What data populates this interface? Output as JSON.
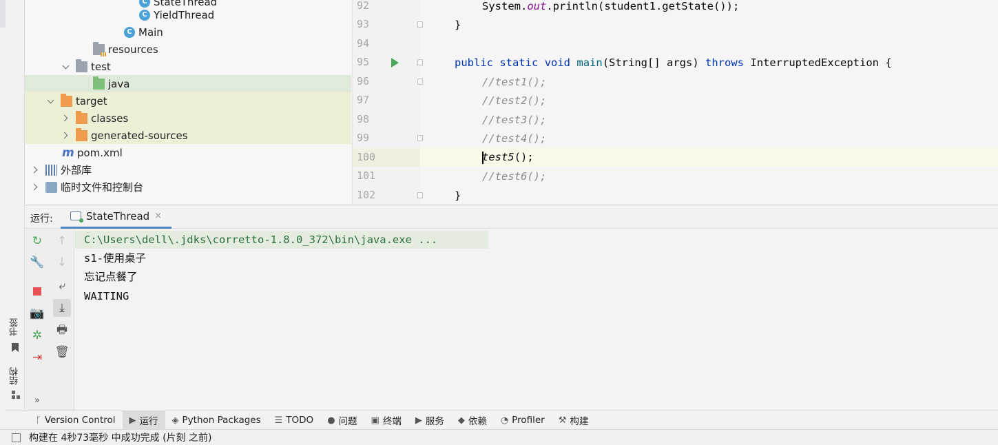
{
  "project_tree": {
    "items": [
      {
        "label": "StateThread",
        "icon": "java-class-icon"
      },
      {
        "label": "YieldThread",
        "icon": "java-class-icon"
      },
      {
        "label": "Main",
        "icon": "java-class-icon"
      },
      {
        "label": "resources",
        "icon": "resources-folder-icon"
      },
      {
        "label": "test",
        "icon": "folder-icon"
      },
      {
        "label": "java",
        "icon": "test-source-folder-icon"
      },
      {
        "label": "target",
        "icon": "excluded-folder-icon"
      },
      {
        "label": "classes",
        "icon": "excluded-folder-icon"
      },
      {
        "label": "generated-sources",
        "icon": "excluded-folder-icon"
      },
      {
        "label": "pom.xml",
        "icon": "maven-icon"
      },
      {
        "label": "外部库",
        "icon": "library-icon"
      },
      {
        "label": "临时文件和控制台",
        "icon": "scratch-icon"
      }
    ]
  },
  "editor": {
    "lines": [
      {
        "num": "92",
        "text": "System.out.println(student1.getState());"
      },
      {
        "num": "93",
        "text": "}"
      },
      {
        "num": "94",
        "text": ""
      },
      {
        "num": "95",
        "text": "public static void main(String[] args) throws InterruptedException {"
      },
      {
        "num": "96",
        "text": "//test1();"
      },
      {
        "num": "97",
        "text": "//test2();"
      },
      {
        "num": "98",
        "text": "//test3();"
      },
      {
        "num": "99",
        "text": "//test4();"
      },
      {
        "num": "100",
        "text": "test5();"
      },
      {
        "num": "101",
        "text": "//test6();"
      },
      {
        "num": "102",
        "text": "}"
      }
    ],
    "tokens": {
      "system": "System.",
      "out": "out",
      "println": ".println(student1.getState());",
      "brace_close": "}",
      "kw_public": "public",
      "kw_static": "static",
      "kw_void": "void",
      "main": "main",
      "main_params": "(String[] args)",
      "kw_throws": "throws",
      "exception": "InterruptedException {",
      "test5": "test5",
      "test5_tail": "();"
    }
  },
  "run": {
    "label": "运行:",
    "tab_title": "StateThread",
    "tab_close": "×",
    "console": [
      "C:\\Users\\dell\\.jdks\\corretto-1.8.0_372\\bin\\java.exe ...",
      "s1-使用桌子",
      "忘记点餐了",
      "WAITING"
    ]
  },
  "left_stripe": {
    "bookmarks": "书签",
    "structure": "结构",
    "more": "»"
  },
  "tool_windows": [
    {
      "label": "Version Control",
      "icon": "version-control-icon"
    },
    {
      "label": "运行",
      "icon": "run-icon"
    },
    {
      "label": "Python Packages",
      "icon": "python-packages-icon"
    },
    {
      "label": "TODO",
      "icon": "todo-icon"
    },
    {
      "label": "问题",
      "icon": "problems-icon"
    },
    {
      "label": "终端",
      "icon": "terminal-icon"
    },
    {
      "label": "服务",
      "icon": "services-icon"
    },
    {
      "label": "依赖",
      "icon": "dependencies-icon"
    },
    {
      "label": "Profiler",
      "icon": "profiler-icon"
    },
    {
      "label": "构建",
      "icon": "build-icon"
    }
  ],
  "status_bar": {
    "message": "构建在 4秒73毫秒 中成功完成 (片刻 之前)"
  },
  "colors": {
    "accent": "#4a86c8",
    "run_green": "#4ca65a",
    "stop_red": "#e55353",
    "keyword": "#0033b3",
    "comment": "#8c8c8c"
  }
}
